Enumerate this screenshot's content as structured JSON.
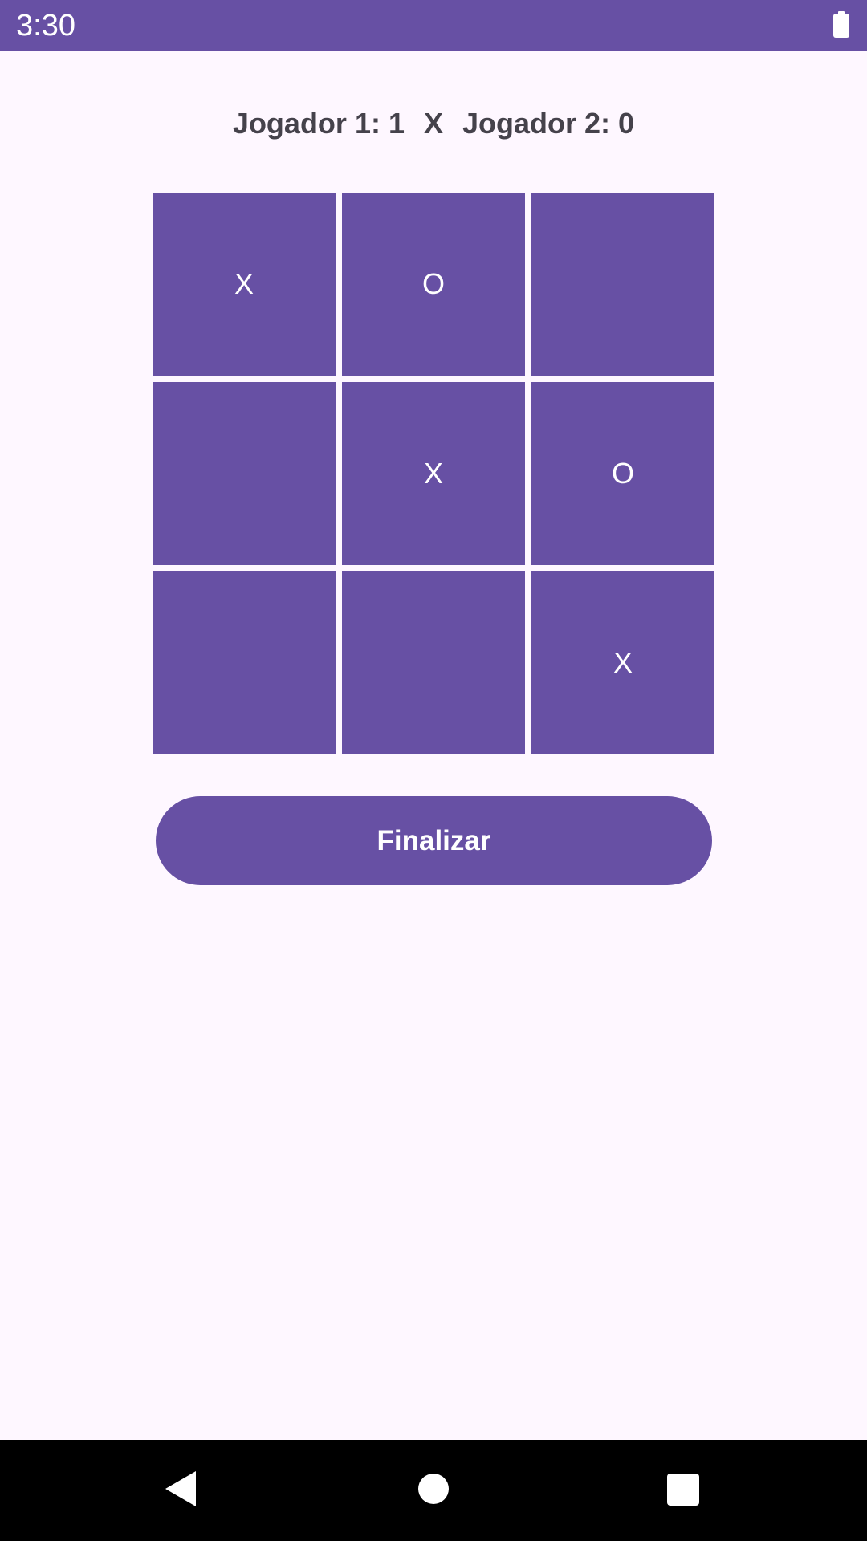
{
  "status_bar": {
    "time": "3:30",
    "battery_icon": "battery-full-icon"
  },
  "score": {
    "player1": "Jogador 1: 1",
    "separator": "X",
    "player2": "Jogador 2: 0"
  },
  "board": {
    "cells": [
      "X",
      "O",
      "",
      "",
      "X",
      "O",
      "",
      "",
      "X"
    ]
  },
  "finish_button": {
    "label": "Finalizar"
  },
  "nav_bar": {
    "back_icon": "back-triangle-icon",
    "home_icon": "home-circle-icon",
    "recents_icon": "recents-square-icon"
  },
  "colors": {
    "primary": "#6750A4",
    "background": "#FEF7FF",
    "score_text": "#45424B"
  }
}
